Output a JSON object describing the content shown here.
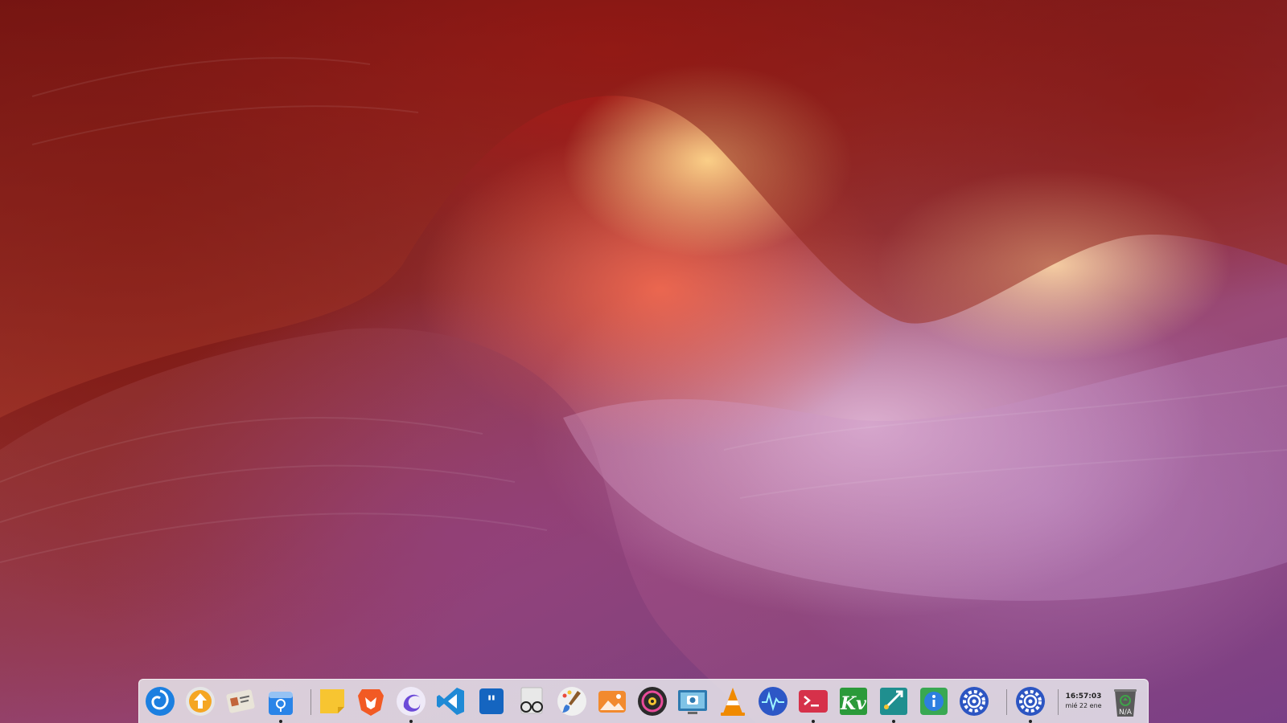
{
  "dock": {
    "items": [
      {
        "name": "launcher",
        "icon": "deepin-launcher-icon",
        "color": "#1c7fe0",
        "running": false
      },
      {
        "name": "update-manager",
        "icon": "update-arrow-icon",
        "color": "#f5a623",
        "running": false
      },
      {
        "name": "contacts",
        "icon": "contact-card-icon",
        "color": "#e9e4d8",
        "running": false
      },
      {
        "name": "app-store",
        "icon": "store-bag-icon",
        "color": "#2a84e8",
        "running": true
      },
      {
        "name": "sticky-notes",
        "icon": "sticky-note-icon",
        "color": "#f7c531",
        "running": false
      },
      {
        "name": "brave-browser",
        "icon": "brave-lion-icon",
        "color": "#f25a24",
        "running": false
      },
      {
        "name": "web-browser",
        "icon": "swirl-browser-icon",
        "color": "#6c4ad8",
        "running": true
      },
      {
        "name": "vs-code",
        "icon": "vscode-icon",
        "color": "#1f8ad6",
        "running": false
      },
      {
        "name": "quotes-app",
        "icon": "quote-bubble-icon",
        "color": "#1565c0",
        "running": false
      },
      {
        "name": "document-viewer",
        "icon": "reading-glasses-icon",
        "color": "#e8e8e8",
        "running": false
      },
      {
        "name": "paint-app",
        "icon": "paintbrush-icon",
        "color": "#f0f0f0",
        "running": false
      },
      {
        "name": "image-viewer",
        "icon": "photo-landscape-icon",
        "color": "#f28a2e",
        "running": false
      },
      {
        "name": "music-player",
        "icon": "vinyl-disc-icon",
        "color": "#2b2b2b",
        "running": false
      },
      {
        "name": "screenshot-tool",
        "icon": "screenshot-camera-icon",
        "color": "#2e7ab0",
        "running": false
      },
      {
        "name": "vlc-media-player",
        "icon": "vlc-cone-icon",
        "color": "#f08a00",
        "running": false
      },
      {
        "name": "system-monitor",
        "icon": "cpu-monitor-icon",
        "color": "#2d57c6",
        "running": false
      },
      {
        "name": "terminal",
        "icon": "terminal-prompt-icon",
        "color": "#d6314a",
        "running": true
      },
      {
        "name": "kv-editor",
        "icon": "kv-logo-icon",
        "color": "#2b9a3a",
        "running": false
      },
      {
        "name": "remote-connect",
        "icon": "remote-arrows-icon",
        "color": "#1f8f8f",
        "running": true
      },
      {
        "name": "system-info",
        "icon": "info-circle-icon",
        "color": "#39a852",
        "running": false
      },
      {
        "name": "control-center",
        "icon": "gear-settings-icon",
        "color": "#2c55c2",
        "running": false
      },
      {
        "name": "settings",
        "icon": "gear-settings-icon",
        "color": "#2c55c2",
        "running": true
      }
    ],
    "clock": {
      "time": "16:57:03",
      "date": "mié 22 ene"
    },
    "trash": {
      "icon": "trash-bin-icon",
      "label": "N/A"
    }
  },
  "colors": {
    "dock_background": "#e8e8ec",
    "run_indicator": "#222222"
  }
}
